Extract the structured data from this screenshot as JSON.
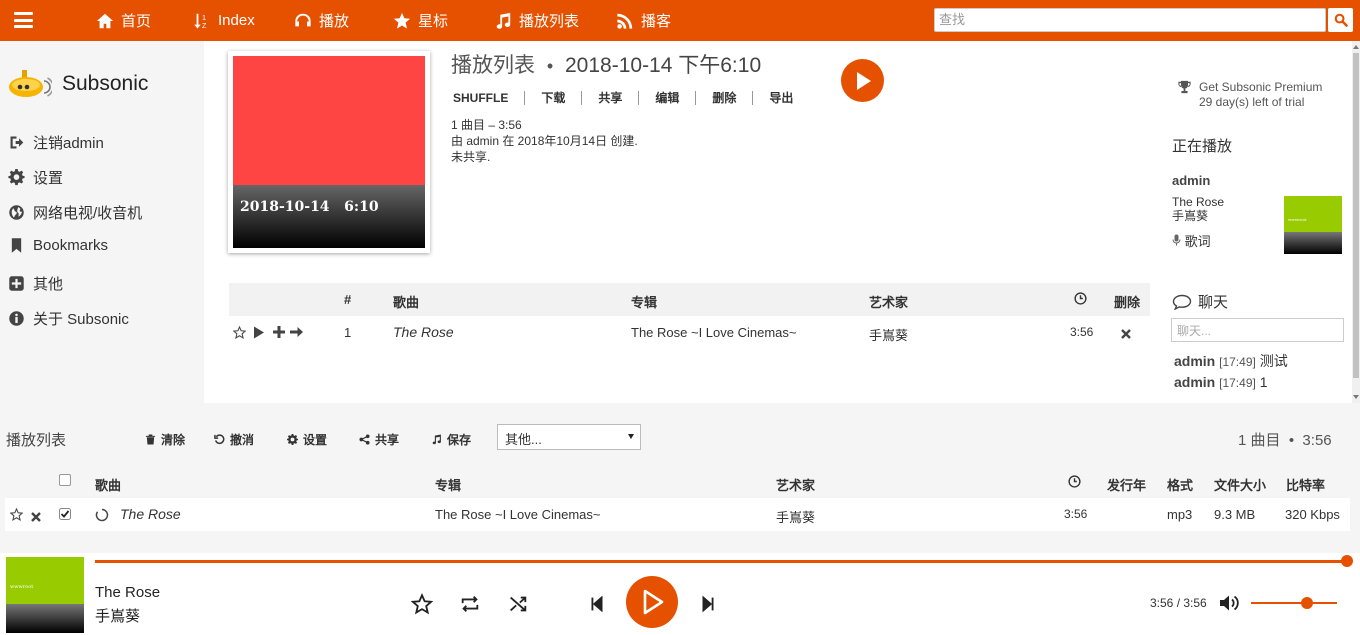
{
  "nav": {
    "items": [
      {
        "label": "首页",
        "icon": "home-icon"
      },
      {
        "label": "Index",
        "icon": "sort-alpha-icon"
      },
      {
        "label": "播放",
        "icon": "headphones-icon"
      },
      {
        "label": "星标",
        "icon": "star-icon"
      },
      {
        "label": "播放列表",
        "icon": "music-icon"
      },
      {
        "label": "播客",
        "icon": "rss-icon"
      }
    ],
    "search_placeholder": "查找"
  },
  "sidebar": {
    "app_name": "Subsonic",
    "items": [
      {
        "label": "注销admin",
        "icon": "sign-out-icon"
      },
      {
        "label": "设置",
        "icon": "gear-icon"
      },
      {
        "label": "网络电视/收音机",
        "icon": "globe-icon"
      },
      {
        "label": "Bookmarks",
        "icon": "bookmark-icon"
      },
      {
        "label": "其他",
        "icon": "plus-square-icon"
      },
      {
        "label": "关于 Subsonic",
        "icon": "info-circle-icon"
      }
    ]
  },
  "playlist": {
    "cover_text": "2018-10-14   6:10",
    "title_prefix": "播放列表",
    "title_sep": "•",
    "title_name": "2018-10-14 下午6:10",
    "actions": [
      "SHUFFLE",
      "下载",
      "共享",
      "编辑",
      "删除",
      "导出"
    ],
    "meta": [
      "1 曲目 – 3:56",
      "由 admin 在 2018年10月14日 创建.",
      "未共享."
    ],
    "headers": {
      "num": "#",
      "song": "歌曲",
      "album": "专辑",
      "artist": "艺术家",
      "delete": "删除"
    },
    "rows": [
      {
        "num": "1",
        "song": "The Rose",
        "album": "The Rose ~I Love Cinemas~",
        "artist": "手嶌葵",
        "duration": "3:56"
      }
    ]
  },
  "right_panel": {
    "premium_title": "Get Subsonic Premium",
    "premium_sub": "29 day(s) left of trial",
    "now_playing_title": "正在播放",
    "user": "admin",
    "song": "The Rose",
    "artist": "手嶌葵",
    "lyrics": "歌词",
    "thumb_text": "wwwroot",
    "chat_title": "聊天",
    "chat_placeholder": "聊天...",
    "messages": [
      {
        "user": "admin",
        "time": "[17:49]",
        "text": "测试"
      },
      {
        "user": "admin",
        "time": "[17:49]",
        "text": "1"
      }
    ]
  },
  "queue": {
    "title": "播放列表",
    "actions": [
      {
        "label": "清除",
        "icon": "trash-icon"
      },
      {
        "label": "撤消",
        "icon": "undo-icon"
      },
      {
        "label": "设置",
        "icon": "gear-icon"
      },
      {
        "label": "共享",
        "icon": "share-icon"
      },
      {
        "label": "保存",
        "icon": "music-icon"
      }
    ],
    "select_value": "其他...",
    "count": "1 曲目  •  3:56",
    "headers": {
      "song": "歌曲",
      "album": "专辑",
      "artist": "艺术家",
      "year": "发行年",
      "format": "格式",
      "size": "文件大小",
      "bitrate": "比特率"
    },
    "rows": [
      {
        "song": "The Rose",
        "album": "The Rose ~I Love Cinemas~",
        "artist": "手嶌葵",
        "duration": "3:56",
        "format": "mp3",
        "size": "9.3 MB",
        "bitrate": "320 Kbps",
        "checked": true
      }
    ]
  },
  "player": {
    "title": "The Rose",
    "artist": "手嶌葵",
    "time": "3:56 / 3:56",
    "progress": 1.0,
    "volume": 0.65,
    "thumb_text": "wwwroot"
  },
  "colors": {
    "accent": "#e65100",
    "cover_red": "#ff4444",
    "thumb_green": "#99cc00"
  }
}
